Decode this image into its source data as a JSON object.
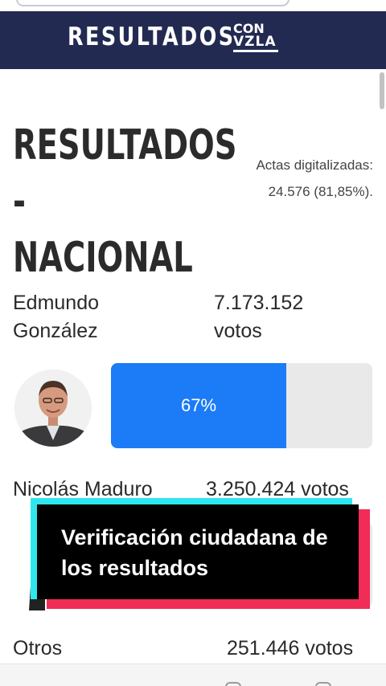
{
  "header": {
    "brand": "RESULTADOS",
    "logo_line1": "CON",
    "logo_line2": "VZLA"
  },
  "page": {
    "title": "RESULTADOS\n- NACIONAL",
    "actas_label": "Actas digitalizadas:",
    "actas_value": "24.576 (81,85%)."
  },
  "candidates": [
    {
      "name": "Edmundo\nGonzález",
      "votes": "7.173.152\nvotos",
      "percent_label": "67%",
      "percent": 67
    },
    {
      "name": "Nicolás Maduro",
      "votes": "3.250.424 votos"
    },
    {
      "name": "Otros",
      "votes": "251.446 votos"
    }
  ],
  "overlay": {
    "caption": "Verificación ciudadana de los resultados"
  },
  "colors": {
    "header_bg": "#232a52",
    "bar_fill": "#1c7bf6",
    "bar_track": "#e9e9ea",
    "overlay_cyan": "#2ee6ee",
    "overlay_red": "#f12c57"
  }
}
